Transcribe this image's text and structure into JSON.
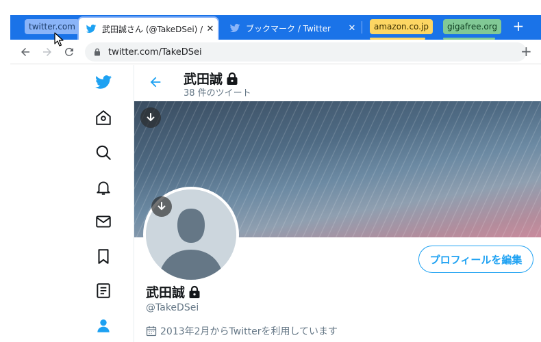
{
  "browser": {
    "tab_groups": [
      {
        "label": "twitter.com",
        "color": "#8ab4f8"
      },
      {
        "label": "amazon.co.jp",
        "color": "#fdd663"
      },
      {
        "label": "gigafree.org",
        "color": "#81c995"
      }
    ],
    "tabs": [
      {
        "title": "武田誠さん (@TakeDSei) / Twitter",
        "close": "✕",
        "active": true
      },
      {
        "title": "ブックマーク / Twitter",
        "close": "✕",
        "active": false
      }
    ],
    "new_tab": "+",
    "address_url": "twitter.com/TakeDSei",
    "toolbar_plus": "+",
    "accent": "#1a73e8"
  },
  "twitter": {
    "brand_color": "#1da1f2",
    "sidebar": [
      {
        "icon": "twitter-bird-icon"
      },
      {
        "icon": "home-icon"
      },
      {
        "icon": "search-icon"
      },
      {
        "icon": "bell-icon"
      },
      {
        "icon": "mail-icon"
      },
      {
        "icon": "bookmark-icon"
      },
      {
        "icon": "list-icon"
      },
      {
        "icon": "profile-icon"
      }
    ],
    "header": {
      "name": "武田誠",
      "tweet_count": "38 件のツイート"
    },
    "profile": {
      "display_name": "武田誠",
      "handle": "@TakeDSei",
      "joined": "2013年2月からTwitterを利用しています",
      "edit_button": "プロフィールを編集"
    }
  }
}
